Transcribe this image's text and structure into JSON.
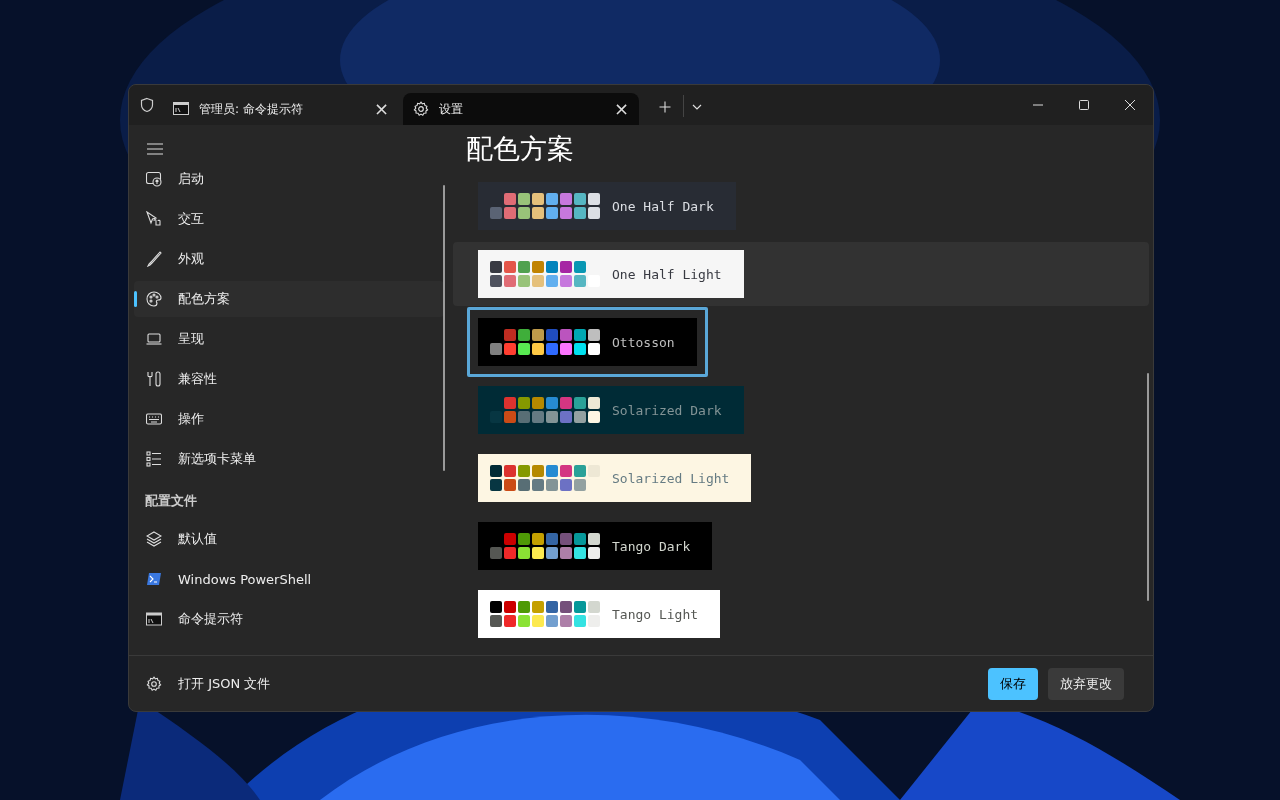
{
  "tabs": [
    {
      "label": "管理员: 命令提示符",
      "close": "×",
      "selected": false
    },
    {
      "label": "设置",
      "close": "×",
      "selected": true
    }
  ],
  "sidebar": {
    "items": [
      {
        "label": "启动",
        "selected": false
      },
      {
        "label": "交互",
        "selected": false
      },
      {
        "label": "外观",
        "selected": false
      },
      {
        "label": "配色方案",
        "selected": true
      },
      {
        "label": "呈现",
        "selected": false
      },
      {
        "label": "兼容性",
        "selected": false
      },
      {
        "label": "操作",
        "selected": false
      },
      {
        "label": "新选项卡菜单",
        "selected": false
      }
    ],
    "section_title": "配置文件",
    "profiles": [
      {
        "label": "默认值",
        "selected": false
      },
      {
        "label": "Windows PowerShell",
        "selected": false
      },
      {
        "label": "命令提示符",
        "selected": false
      }
    ],
    "footer_item": "打开 JSON 文件"
  },
  "page_title": "配色方案",
  "schemes": [
    {
      "label": {
        "text": "One Half Dark",
        "color": "#dcdfe4"
      },
      "color": "#282c34",
      "selected": false,
      "hovered": false,
      "swatches": [
        {
          "kind": "blank"
        },
        {
          "kind": "chip",
          "color": "#e06c75"
        },
        {
          "kind": "chip",
          "color": "#98c379"
        },
        {
          "kind": "chip",
          "color": "#e5c07b"
        },
        {
          "kind": "chip",
          "color": "#61afef"
        },
        {
          "kind": "chip",
          "color": "#c678dd"
        },
        {
          "kind": "chip",
          "color": "#56b6c2"
        },
        {
          "kind": "chip",
          "color": "#dcdfe4"
        },
        {
          "kind": "chip",
          "color": "#5a6374"
        },
        {
          "kind": "chip",
          "color": "#e06c75"
        },
        {
          "kind": "chip",
          "color": "#98c379"
        },
        {
          "kind": "chip",
          "color": "#e5c07b"
        },
        {
          "kind": "chip",
          "color": "#61afef"
        },
        {
          "kind": "chip",
          "color": "#c678dd"
        },
        {
          "kind": "chip",
          "color": "#56b6c2"
        },
        {
          "kind": "chip",
          "color": "#dcdfe4"
        }
      ]
    },
    {
      "label": {
        "text": "One Half Light",
        "color": "#383a42"
      },
      "color": "#f6f6f6",
      "selected": false,
      "hovered": true,
      "swatches": [
        {
          "kind": "chip",
          "color": "#383a42"
        },
        {
          "kind": "chip",
          "color": "#e45649"
        },
        {
          "kind": "chip",
          "color": "#50a14f"
        },
        {
          "kind": "chip",
          "color": "#c18301"
        },
        {
          "kind": "chip",
          "color": "#0184bc"
        },
        {
          "kind": "chip",
          "color": "#a626a4"
        },
        {
          "kind": "chip",
          "color": "#0997b3"
        },
        {
          "kind": "blank"
        },
        {
          "kind": "chip",
          "color": "#4f525e"
        },
        {
          "kind": "chip",
          "color": "#e06c75"
        },
        {
          "kind": "chip",
          "color": "#98c379"
        },
        {
          "kind": "chip",
          "color": "#e5c07b"
        },
        {
          "kind": "chip",
          "color": "#61afef"
        },
        {
          "kind": "chip",
          "color": "#c678dd"
        },
        {
          "kind": "chip",
          "color": "#56b6c2"
        },
        {
          "kind": "chip",
          "color": "#ffffff"
        }
      ]
    },
    {
      "label": {
        "text": "Ottosson",
        "color": "#bebebe"
      },
      "color": "#000000",
      "selected": true,
      "hovered": false,
      "swatches": [
        {
          "kind": "blank"
        },
        {
          "kind": "chip",
          "color": "#be2c21"
        },
        {
          "kind": "chip",
          "color": "#3fae3a"
        },
        {
          "kind": "chip",
          "color": "#be9a4a"
        },
        {
          "kind": "chip",
          "color": "#204dbe"
        },
        {
          "kind": "chip",
          "color": "#bb54be"
        },
        {
          "kind": "chip",
          "color": "#00a7b2"
        },
        {
          "kind": "chip",
          "color": "#bebebe"
        },
        {
          "kind": "chip",
          "color": "#808080"
        },
        {
          "kind": "chip",
          "color": "#ff3e30"
        },
        {
          "kind": "chip",
          "color": "#58ea51"
        },
        {
          "kind": "chip",
          "color": "#ffc944"
        },
        {
          "kind": "chip",
          "color": "#2f6aff"
        },
        {
          "kind": "chip",
          "color": "#fc74ff"
        },
        {
          "kind": "chip",
          "color": "#00e1f0"
        },
        {
          "kind": "chip",
          "color": "#ffffff"
        }
      ]
    },
    {
      "label": {
        "text": "Solarized Dark",
        "color": "#839496"
      },
      "color": "#002b36",
      "selected": false,
      "hovered": false,
      "swatches": [
        {
          "kind": "blank"
        },
        {
          "kind": "chip",
          "color": "#dc322f"
        },
        {
          "kind": "chip",
          "color": "#859900"
        },
        {
          "kind": "chip",
          "color": "#b58900"
        },
        {
          "kind": "chip",
          "color": "#268bd2"
        },
        {
          "kind": "chip",
          "color": "#d33682"
        },
        {
          "kind": "chip",
          "color": "#2aa198"
        },
        {
          "kind": "chip",
          "color": "#eee8d5"
        },
        {
          "kind": "chip",
          "color": "#073642"
        },
        {
          "kind": "chip",
          "color": "#cb4b16"
        },
        {
          "kind": "chip",
          "color": "#586e75"
        },
        {
          "kind": "chip",
          "color": "#657b83"
        },
        {
          "kind": "chip",
          "color": "#839496"
        },
        {
          "kind": "chip",
          "color": "#6c71c4"
        },
        {
          "kind": "chip",
          "color": "#93a1a1"
        },
        {
          "kind": "chip",
          "color": "#fdf6e3"
        }
      ]
    },
    {
      "label": {
        "text": "Solarized Light",
        "color": "#657b83"
      },
      "color": "#fdf6e3",
      "selected": false,
      "hovered": false,
      "swatches": [
        {
          "kind": "chip",
          "color": "#002b36"
        },
        {
          "kind": "chip",
          "color": "#dc322f"
        },
        {
          "kind": "chip",
          "color": "#859900"
        },
        {
          "kind": "chip",
          "color": "#b58900"
        },
        {
          "kind": "chip",
          "color": "#268bd2"
        },
        {
          "kind": "chip",
          "color": "#d33682"
        },
        {
          "kind": "chip",
          "color": "#2aa198"
        },
        {
          "kind": "chip",
          "color": "#eee8d5"
        },
        {
          "kind": "chip",
          "color": "#073642"
        },
        {
          "kind": "chip",
          "color": "#cb4b16"
        },
        {
          "kind": "chip",
          "color": "#586e75"
        },
        {
          "kind": "chip",
          "color": "#657b83"
        },
        {
          "kind": "chip",
          "color": "#839496"
        },
        {
          "kind": "chip",
          "color": "#6c71c4"
        },
        {
          "kind": "chip",
          "color": "#93a1a1"
        },
        {
          "kind": "blank"
        }
      ]
    },
    {
      "label": {
        "text": "Tango Dark",
        "color": "#d3d7cf"
      },
      "color": "#000000",
      "selected": false,
      "hovered": false,
      "swatches": [
        {
          "kind": "blank"
        },
        {
          "kind": "chip",
          "color": "#cc0000"
        },
        {
          "kind": "chip",
          "color": "#4e9a06"
        },
        {
          "kind": "chip",
          "color": "#c4a000"
        },
        {
          "kind": "chip",
          "color": "#3465a4"
        },
        {
          "kind": "chip",
          "color": "#75507b"
        },
        {
          "kind": "chip",
          "color": "#06989a"
        },
        {
          "kind": "chip",
          "color": "#d3d7cf"
        },
        {
          "kind": "chip",
          "color": "#555753"
        },
        {
          "kind": "chip",
          "color": "#ef2929"
        },
        {
          "kind": "chip",
          "color": "#8ae234"
        },
        {
          "kind": "chip",
          "color": "#fce94f"
        },
        {
          "kind": "chip",
          "color": "#729fcf"
        },
        {
          "kind": "chip",
          "color": "#ad7fa8"
        },
        {
          "kind": "chip",
          "color": "#34e2e2"
        },
        {
          "kind": "chip",
          "color": "#eeeeec"
        }
      ]
    },
    {
      "label": {
        "text": "Tango Light",
        "color": "#555753"
      },
      "color": "#ffffff",
      "selected": false,
      "hovered": false,
      "swatches": [
        {
          "kind": "chip",
          "color": "#000000"
        },
        {
          "kind": "chip",
          "color": "#cc0000"
        },
        {
          "kind": "chip",
          "color": "#4e9a06"
        },
        {
          "kind": "chip",
          "color": "#c4a000"
        },
        {
          "kind": "chip",
          "color": "#3465a4"
        },
        {
          "kind": "chip",
          "color": "#75507b"
        },
        {
          "kind": "chip",
          "color": "#06989a"
        },
        {
          "kind": "chip",
          "color": "#d3d7cf"
        },
        {
          "kind": "chip",
          "color": "#555753"
        },
        {
          "kind": "chip",
          "color": "#ef2929"
        },
        {
          "kind": "chip",
          "color": "#8ae234"
        },
        {
          "kind": "chip",
          "color": "#fce94f"
        },
        {
          "kind": "chip",
          "color": "#729fcf"
        },
        {
          "kind": "chip",
          "color": "#ad7fa8"
        },
        {
          "kind": "chip",
          "color": "#34e2e2"
        },
        {
          "kind": "chip",
          "color": "#eeeeec"
        }
      ]
    }
  ],
  "buttons": [
    {
      "label": "保存",
      "kind": "primary"
    },
    {
      "label": "放弃更改",
      "kind": "secondary"
    }
  ]
}
